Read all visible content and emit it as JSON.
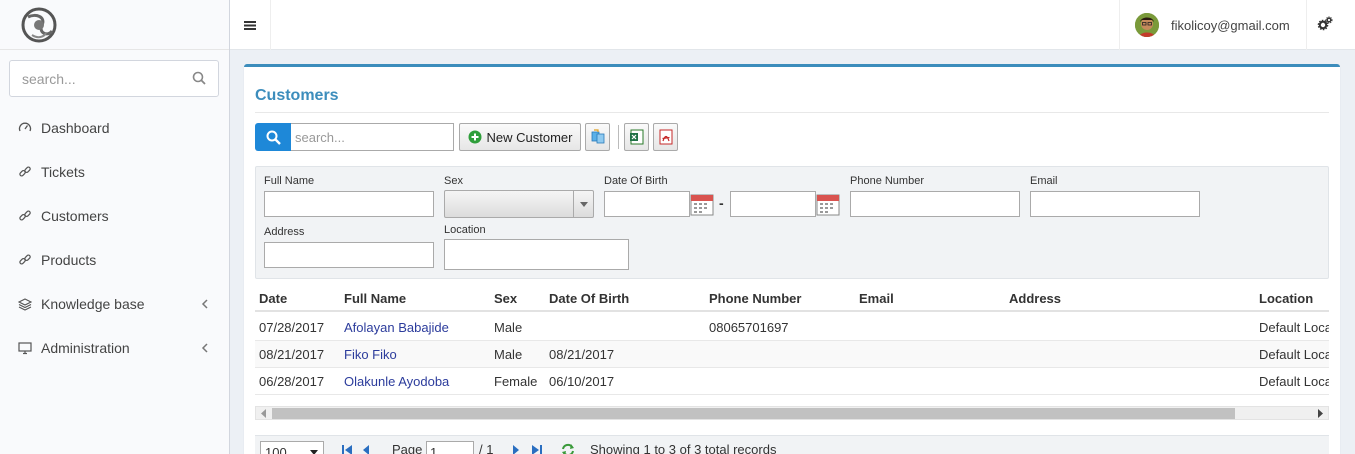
{
  "sidebar": {
    "search_placeholder": "search...",
    "items": [
      {
        "label": "Dashboard",
        "icon": "dashboard-icon"
      },
      {
        "label": "Tickets",
        "icon": "link-icon"
      },
      {
        "label": "Customers",
        "icon": "link-icon"
      },
      {
        "label": "Products",
        "icon": "link-icon"
      },
      {
        "label": "Knowledge base",
        "icon": "layers-icon",
        "has_submenu": true
      },
      {
        "label": "Administration",
        "icon": "monitor-icon",
        "has_submenu": true
      }
    ]
  },
  "header": {
    "user_email": "fikolicoy@gmail.com"
  },
  "page": {
    "title": "Customers",
    "search_placeholder": "search...",
    "new_customer_label": "New Customer"
  },
  "filters": {
    "full_name": "Full Name",
    "sex": "Sex",
    "date_of_birth": "Date Of Birth",
    "date_separator": "-",
    "phone_number": "Phone Number",
    "email": "Email",
    "address": "Address",
    "location": "Location"
  },
  "table": {
    "columns": [
      "Date",
      "Full Name",
      "Sex",
      "Date Of Birth",
      "Phone Number",
      "Email",
      "Address",
      "Location"
    ],
    "rows": [
      {
        "date": "07/28/2017",
        "full_name": "Afolayan Babajide",
        "sex": "Male",
        "dob": "",
        "phone": "08065701697",
        "email": "",
        "address": "",
        "location": "Default Loca"
      },
      {
        "date": "08/21/2017",
        "full_name": "Fiko Fiko",
        "sex": "Male",
        "dob": "08/21/2017",
        "phone": "",
        "email": "",
        "address": "",
        "location": "Default Loca"
      },
      {
        "date": "06/28/2017",
        "full_name": "Olakunle Ayodoba",
        "sex": "Female",
        "dob": "06/10/2017",
        "phone": "",
        "email": "",
        "address": "",
        "location": "Default Loca"
      }
    ]
  },
  "pager": {
    "page_size": "100",
    "page_label": "Page",
    "page_value": "1",
    "page_total": "/ 1",
    "showing": "Showing 1 to 3 of 3 total records"
  },
  "colors": {
    "accent": "#3c8dbc",
    "search_button": "#1e88d8",
    "link": "#2c3c9c"
  }
}
